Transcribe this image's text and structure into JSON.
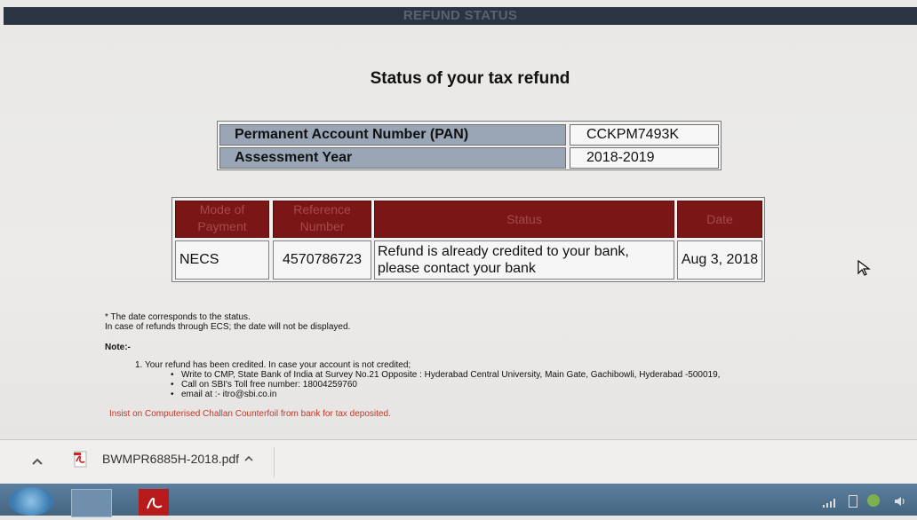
{
  "window": {
    "title": "REFUND STATUS"
  },
  "heading": "Status of your tax refund",
  "pan_table": {
    "rows": [
      {
        "label": "Permanent Account Number (PAN)",
        "value": "CCKPM7493K"
      },
      {
        "label": "Assessment Year",
        "value": "2018-2019"
      }
    ]
  },
  "refund_table": {
    "headers": {
      "mode": [
        "Mode of",
        "Payment"
      ],
      "reference": [
        "Reference",
        "Number"
      ],
      "status": "Status",
      "date": "Date"
    },
    "row": {
      "mode": "NECS",
      "reference": "4570786723",
      "status": [
        "Refund is already credited to your bank,",
        "please contact your bank"
      ],
      "date": "Aug 3, 2018"
    }
  },
  "notes": {
    "date_note_1": "* The date corresponds to the status.",
    "date_note_2": "In case of refunds through ECS; the date will not be displayed.",
    "note_label": "Note:-",
    "note_item": "1. Your refund has been credited. In case your account is not credited;",
    "bullets": [
      "Write to CMP, State Bank of India at Survey No.21 Opposite : Hyderabad Central University, Main Gate, Gachibowli, Hyderabad -500019,",
      "Call on SBI's Toll free number: 18004259760",
      "email at :- itro@sbi.co.in"
    ],
    "insist": "Insist on Computerised Challan Counterfoil from bank for tax deposited."
  },
  "download_bar": {
    "filename": "BWMPR6885H-2018.pdf"
  },
  "colors": {
    "header_bar": "#2b3442",
    "table_header": "#7a1616",
    "pan_label_bg": "#9aa6b6",
    "warning_text": "#c0392b"
  }
}
